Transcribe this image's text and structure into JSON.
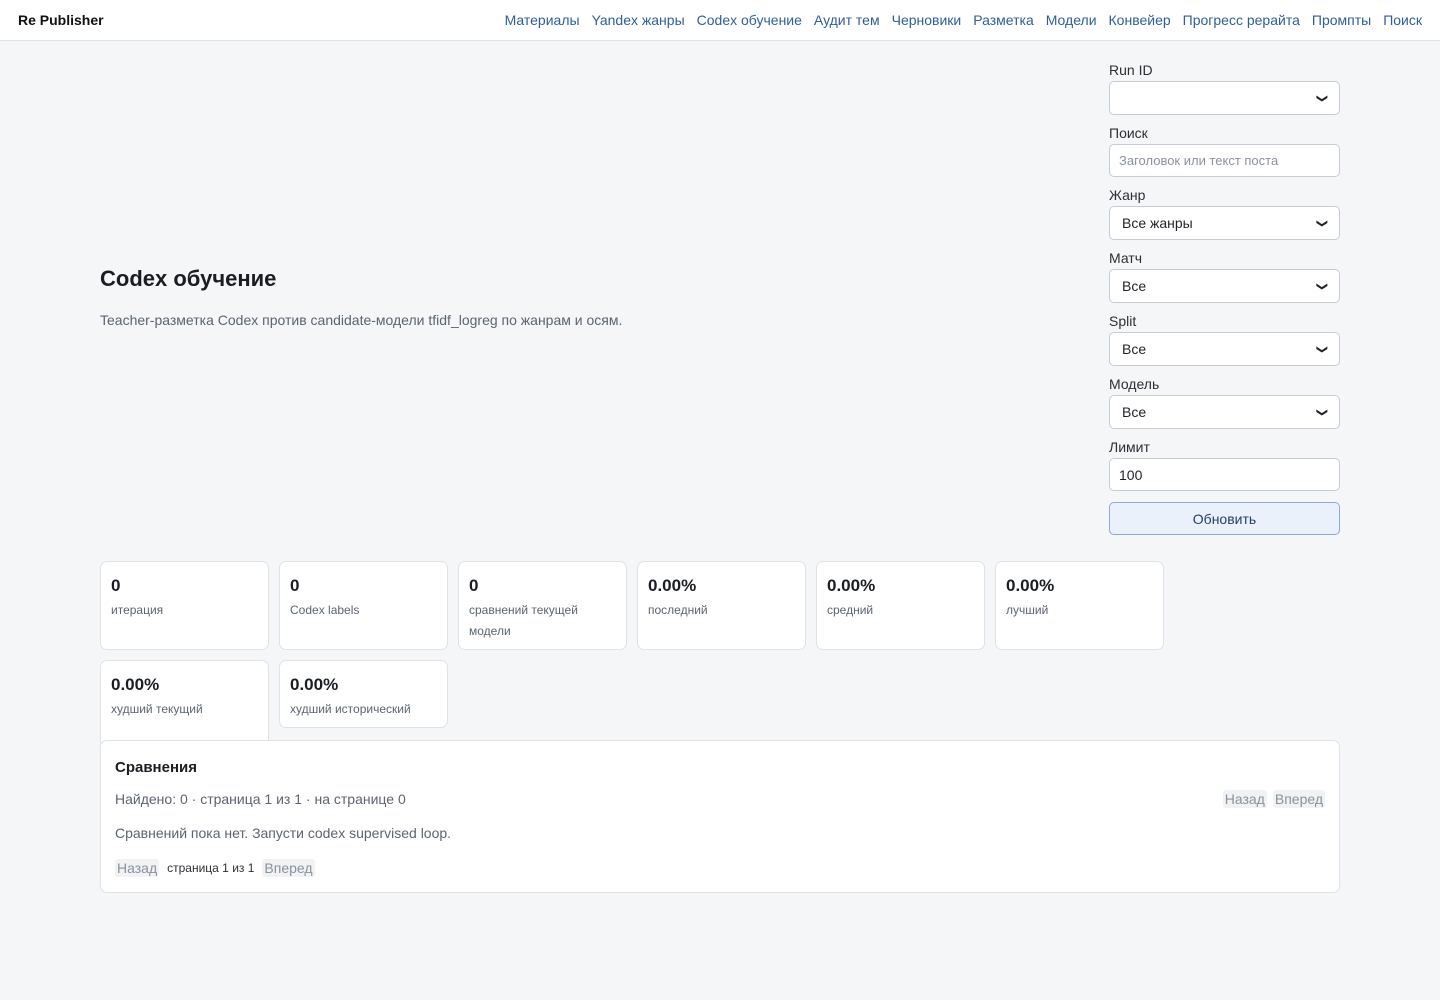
{
  "brand": "Re Publisher",
  "nav": [
    "Материалы",
    "Yandex жанры",
    "Codex обучение",
    "Аудит тем",
    "Черновики",
    "Разметка",
    "Модели",
    "Конвейер",
    "Прогресс рерайта",
    "Промпты",
    "Поиск"
  ],
  "hero": {
    "title": "Codex обучение",
    "subtitle": "Teacher-разметка Codex против candidate-модели tfidf_logreg по жанрам и осям."
  },
  "filters": {
    "run_id": {
      "label": "Run ID",
      "value": ""
    },
    "search": {
      "label": "Поиск",
      "placeholder": "Заголовок или текст поста"
    },
    "genre": {
      "label": "Жанр",
      "value": "Все жанры"
    },
    "match": {
      "label": "Матч",
      "value": "Все"
    },
    "split": {
      "label": "Split",
      "value": "Все"
    },
    "model": {
      "label": "Модель",
      "value": "Все"
    },
    "limit": {
      "label": "Лимит",
      "value": "100"
    },
    "update_label": "Обновить"
  },
  "stats": [
    {
      "value": "0",
      "label": "итерация"
    },
    {
      "value": "0",
      "label": "Codex labels"
    },
    {
      "value": "0",
      "label": "сравнений текущей модели"
    },
    {
      "value": "0.00%",
      "label": "последний"
    },
    {
      "value": "0.00%",
      "label": "средний"
    },
    {
      "value": "0.00%",
      "label": "лучший"
    },
    {
      "value": "0.00%",
      "label": "худший текущий"
    },
    {
      "value": "0.00%",
      "label": "худший исторический"
    }
  ],
  "comparisons": {
    "title": "Сравнения",
    "meta": "Найдено: 0 · страница 1 из 1 · на странице 0",
    "prev": "Назад",
    "next": "Вперед",
    "empty": "Сравнений пока нет. Запусти codex supervised loop.",
    "page_info": "страница 1 из 1"
  }
}
